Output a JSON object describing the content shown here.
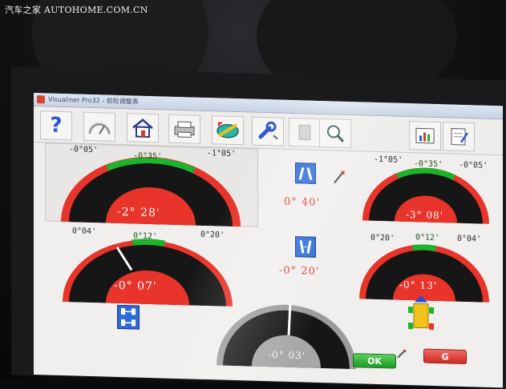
{
  "watermark": "汽车之家  AUTOHOME.COM.CN",
  "window": {
    "title": "Visualiner Pro32 - 前轮调整表"
  },
  "toolbar": {
    "buttons": [
      {
        "name": "help-button",
        "icon": "question-icon"
      },
      {
        "name": "gauge-button",
        "icon": "gauge-icon"
      },
      {
        "name": "home-button",
        "icon": "home-icon"
      },
      {
        "name": "print-button",
        "icon": "printer-icon"
      },
      {
        "name": "measure-button",
        "icon": "tape-icon"
      },
      {
        "name": "adjust-button",
        "icon": "wrench-icon"
      },
      {
        "name": "disabled-button",
        "icon": "blank-icon"
      },
      {
        "name": "zoom-button",
        "icon": "magnifier-icon"
      },
      {
        "name": "report-button",
        "icon": "chart-icon"
      },
      {
        "name": "edit-button",
        "icon": "notepad-icon"
      }
    ],
    "help_glyph": "?"
  },
  "gauges": {
    "left_camber": {
      "min": "-0°05'",
      "target": "-0°35'",
      "max": "-1°05'",
      "value": "-2°  28'",
      "level": 0.0
    },
    "right_camber": {
      "min": "-1°05'",
      "target": "-0°35'",
      "max": "-0°05'",
      "value": "-3°  08'",
      "level": 0.0
    },
    "left_toe": {
      "min": "0°04'",
      "target": "0°12'",
      "max": "0°20'",
      "value": "-0°  07'",
      "level": 0.28
    },
    "right_toe": {
      "min": "0°20'",
      "target": "0°12'",
      "max": "0°04'",
      "value": "-0°  13'",
      "level": 0.0
    },
    "total_toe": {
      "value": "-0°  03'",
      "level": 0.55
    }
  },
  "center": {
    "camber_cross": "0°  40'",
    "toe_cross": "-0°  20'"
  },
  "buttons": {
    "ok": "OK",
    "cancel": "G"
  },
  "colors": {
    "gauge_red": "#e8342a",
    "target_green": "#1db32a",
    "gauge_black": "#161616",
    "value_red": "#e23a30",
    "icon_blue": "#2d6bd8"
  }
}
